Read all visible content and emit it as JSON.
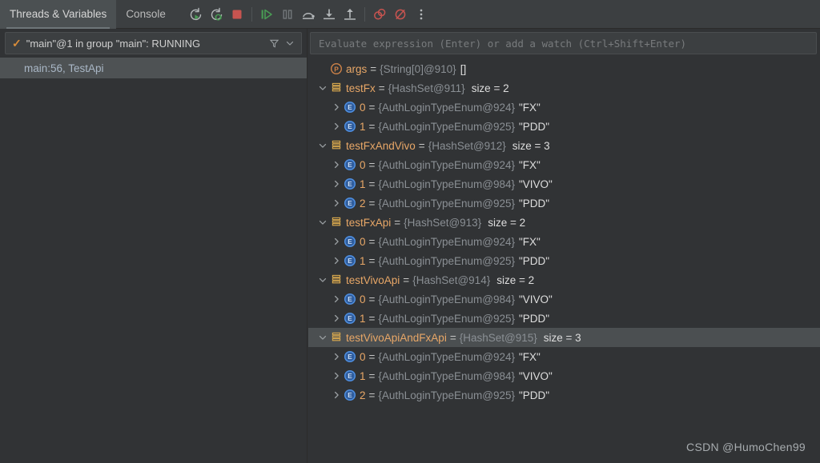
{
  "colors": {
    "background": "#313335",
    "toolbar": "#3c3f41",
    "active_tab": "#4b5052",
    "selection": "#4b4f51",
    "name_orange": "#e8a767",
    "type_grey": "#8a8f94",
    "value_white": "#dedede",
    "accent_green": "#499c54",
    "accent_red": "#c75450",
    "check_orange": "#d98d3a"
  },
  "toolbar": {
    "tabs": [
      {
        "label": "Threads & Variables",
        "active": true
      },
      {
        "label": "Console",
        "active": false
      }
    ],
    "buttons": [
      {
        "name": "rerun-icon",
        "title": "Rerun"
      },
      {
        "name": "rerun-debug-icon",
        "title": "Rerun Debug"
      },
      {
        "name": "stop-icon",
        "title": "Stop"
      },
      {
        "name": "resume-program-icon",
        "title": "Resume Program"
      },
      {
        "name": "pause-program-icon",
        "title": "Pause Program"
      },
      {
        "name": "step-over-icon",
        "title": "Step Over"
      },
      {
        "name": "step-into-icon",
        "title": "Step Into"
      },
      {
        "name": "step-out-icon",
        "title": "Step Out"
      },
      {
        "name": "mute-breakpoints-icon",
        "title": "Mute Breakpoints"
      },
      {
        "name": "view-breakpoints-icon",
        "title": "View Breakpoints"
      },
      {
        "name": "more-options-icon",
        "title": "More"
      }
    ]
  },
  "threads": {
    "selected": "\"main\"@1 in group \"main\": RUNNING",
    "filter_icon": "filter-icon",
    "dropdown_icon": "chevron-down-icon",
    "status_icon": "check-icon",
    "frames": [
      {
        "label": "main:56, TestApi",
        "selected": true
      }
    ]
  },
  "evaluate": {
    "placeholder": "Evaluate expression (Enter) or add a watch (Ctrl+Shift+Enter)"
  },
  "variables": {
    "rows": [
      {
        "depth": 0,
        "twisty": "none",
        "icon": "parameter-icon",
        "name": "args",
        "type": "{String[0]@910}",
        "value": "[]",
        "size": "",
        "selected": false
      },
      {
        "depth": 0,
        "twisty": "expanded",
        "icon": "collection-icon",
        "name": "testFx",
        "type": "{HashSet@911}",
        "value": "",
        "size": "size = 2",
        "selected": false
      },
      {
        "depth": 1,
        "twisty": "collapsed",
        "icon": "enum-icon",
        "name": "0",
        "type": "{AuthLoginTypeEnum@924}",
        "value": "\"FX\"",
        "size": "",
        "selected": false
      },
      {
        "depth": 1,
        "twisty": "collapsed",
        "icon": "enum-icon",
        "name": "1",
        "type": "{AuthLoginTypeEnum@925}",
        "value": "\"PDD\"",
        "size": "",
        "selected": false
      },
      {
        "depth": 0,
        "twisty": "expanded",
        "icon": "collection-icon",
        "name": "testFxAndVivo",
        "type": "{HashSet@912}",
        "value": "",
        "size": "size = 3",
        "selected": false
      },
      {
        "depth": 1,
        "twisty": "collapsed",
        "icon": "enum-icon",
        "name": "0",
        "type": "{AuthLoginTypeEnum@924}",
        "value": "\"FX\"",
        "size": "",
        "selected": false
      },
      {
        "depth": 1,
        "twisty": "collapsed",
        "icon": "enum-icon",
        "name": "1",
        "type": "{AuthLoginTypeEnum@984}",
        "value": "\"VIVO\"",
        "size": "",
        "selected": false
      },
      {
        "depth": 1,
        "twisty": "collapsed",
        "icon": "enum-icon",
        "name": "2",
        "type": "{AuthLoginTypeEnum@925}",
        "value": "\"PDD\"",
        "size": "",
        "selected": false
      },
      {
        "depth": 0,
        "twisty": "expanded",
        "icon": "collection-icon",
        "name": "testFxApi",
        "type": "{HashSet@913}",
        "value": "",
        "size": "size = 2",
        "selected": false
      },
      {
        "depth": 1,
        "twisty": "collapsed",
        "icon": "enum-icon",
        "name": "0",
        "type": "{AuthLoginTypeEnum@924}",
        "value": "\"FX\"",
        "size": "",
        "selected": false
      },
      {
        "depth": 1,
        "twisty": "collapsed",
        "icon": "enum-icon",
        "name": "1",
        "type": "{AuthLoginTypeEnum@925}",
        "value": "\"PDD\"",
        "size": "",
        "selected": false
      },
      {
        "depth": 0,
        "twisty": "expanded",
        "icon": "collection-icon",
        "name": "testVivoApi",
        "type": "{HashSet@914}",
        "value": "",
        "size": "size = 2",
        "selected": false
      },
      {
        "depth": 1,
        "twisty": "collapsed",
        "icon": "enum-icon",
        "name": "0",
        "type": "{AuthLoginTypeEnum@984}",
        "value": "\"VIVO\"",
        "size": "",
        "selected": false
      },
      {
        "depth": 1,
        "twisty": "collapsed",
        "icon": "enum-icon",
        "name": "1",
        "type": "{AuthLoginTypeEnum@925}",
        "value": "\"PDD\"",
        "size": "",
        "selected": false
      },
      {
        "depth": 0,
        "twisty": "expanded",
        "icon": "collection-icon",
        "name": "testVivoApiAndFxApi",
        "type": "{HashSet@915}",
        "value": "",
        "size": "size = 3",
        "selected": true
      },
      {
        "depth": 1,
        "twisty": "collapsed",
        "icon": "enum-icon",
        "name": "0",
        "type": "{AuthLoginTypeEnum@924}",
        "value": "\"FX\"",
        "size": "",
        "selected": false
      },
      {
        "depth": 1,
        "twisty": "collapsed",
        "icon": "enum-icon",
        "name": "1",
        "type": "{AuthLoginTypeEnum@984}",
        "value": "\"VIVO\"",
        "size": "",
        "selected": false
      },
      {
        "depth": 1,
        "twisty": "collapsed",
        "icon": "enum-icon",
        "name": "2",
        "type": "{AuthLoginTypeEnum@925}",
        "value": "\"PDD\"",
        "size": "",
        "selected": false
      }
    ]
  },
  "watermark": {
    "text": "CSDN @HumoChen99"
  }
}
